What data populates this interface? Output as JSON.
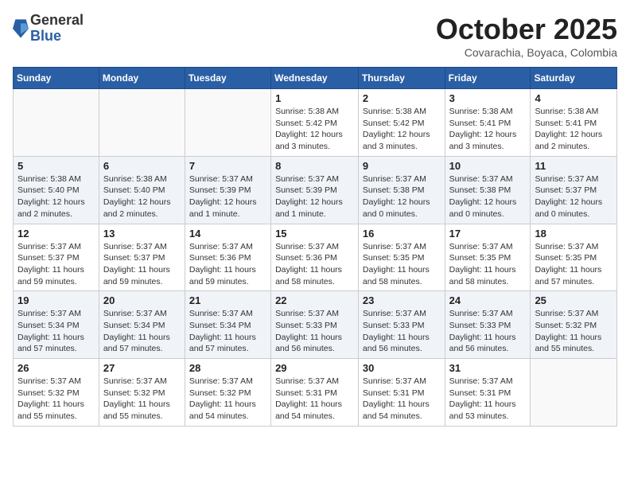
{
  "header": {
    "logo": {
      "general": "General",
      "blue": "Blue"
    },
    "title": "October 2025",
    "subtitle": "Covarachia, Boyaca, Colombia"
  },
  "weekdays": [
    "Sunday",
    "Monday",
    "Tuesday",
    "Wednesday",
    "Thursday",
    "Friday",
    "Saturday"
  ],
  "weeks": [
    [
      {
        "day": "",
        "info": ""
      },
      {
        "day": "",
        "info": ""
      },
      {
        "day": "",
        "info": ""
      },
      {
        "day": "1",
        "info": "Sunrise: 5:38 AM\nSunset: 5:42 PM\nDaylight: 12 hours\nand 3 minutes."
      },
      {
        "day": "2",
        "info": "Sunrise: 5:38 AM\nSunset: 5:42 PM\nDaylight: 12 hours\nand 3 minutes."
      },
      {
        "day": "3",
        "info": "Sunrise: 5:38 AM\nSunset: 5:41 PM\nDaylight: 12 hours\nand 3 minutes."
      },
      {
        "day": "4",
        "info": "Sunrise: 5:38 AM\nSunset: 5:41 PM\nDaylight: 12 hours\nand 2 minutes."
      }
    ],
    [
      {
        "day": "5",
        "info": "Sunrise: 5:38 AM\nSunset: 5:40 PM\nDaylight: 12 hours\nand 2 minutes."
      },
      {
        "day": "6",
        "info": "Sunrise: 5:38 AM\nSunset: 5:40 PM\nDaylight: 12 hours\nand 2 minutes."
      },
      {
        "day": "7",
        "info": "Sunrise: 5:37 AM\nSunset: 5:39 PM\nDaylight: 12 hours\nand 1 minute."
      },
      {
        "day": "8",
        "info": "Sunrise: 5:37 AM\nSunset: 5:39 PM\nDaylight: 12 hours\nand 1 minute."
      },
      {
        "day": "9",
        "info": "Sunrise: 5:37 AM\nSunset: 5:38 PM\nDaylight: 12 hours\nand 0 minutes."
      },
      {
        "day": "10",
        "info": "Sunrise: 5:37 AM\nSunset: 5:38 PM\nDaylight: 12 hours\nand 0 minutes."
      },
      {
        "day": "11",
        "info": "Sunrise: 5:37 AM\nSunset: 5:37 PM\nDaylight: 12 hours\nand 0 minutes."
      }
    ],
    [
      {
        "day": "12",
        "info": "Sunrise: 5:37 AM\nSunset: 5:37 PM\nDaylight: 11 hours\nand 59 minutes."
      },
      {
        "day": "13",
        "info": "Sunrise: 5:37 AM\nSunset: 5:37 PM\nDaylight: 11 hours\nand 59 minutes."
      },
      {
        "day": "14",
        "info": "Sunrise: 5:37 AM\nSunset: 5:36 PM\nDaylight: 11 hours\nand 59 minutes."
      },
      {
        "day": "15",
        "info": "Sunrise: 5:37 AM\nSunset: 5:36 PM\nDaylight: 11 hours\nand 58 minutes."
      },
      {
        "day": "16",
        "info": "Sunrise: 5:37 AM\nSunset: 5:35 PM\nDaylight: 11 hours\nand 58 minutes."
      },
      {
        "day": "17",
        "info": "Sunrise: 5:37 AM\nSunset: 5:35 PM\nDaylight: 11 hours\nand 58 minutes."
      },
      {
        "day": "18",
        "info": "Sunrise: 5:37 AM\nSunset: 5:35 PM\nDaylight: 11 hours\nand 57 minutes."
      }
    ],
    [
      {
        "day": "19",
        "info": "Sunrise: 5:37 AM\nSunset: 5:34 PM\nDaylight: 11 hours\nand 57 minutes."
      },
      {
        "day": "20",
        "info": "Sunrise: 5:37 AM\nSunset: 5:34 PM\nDaylight: 11 hours\nand 57 minutes."
      },
      {
        "day": "21",
        "info": "Sunrise: 5:37 AM\nSunset: 5:34 PM\nDaylight: 11 hours\nand 57 minutes."
      },
      {
        "day": "22",
        "info": "Sunrise: 5:37 AM\nSunset: 5:33 PM\nDaylight: 11 hours\nand 56 minutes."
      },
      {
        "day": "23",
        "info": "Sunrise: 5:37 AM\nSunset: 5:33 PM\nDaylight: 11 hours\nand 56 minutes."
      },
      {
        "day": "24",
        "info": "Sunrise: 5:37 AM\nSunset: 5:33 PM\nDaylight: 11 hours\nand 56 minutes."
      },
      {
        "day": "25",
        "info": "Sunrise: 5:37 AM\nSunset: 5:32 PM\nDaylight: 11 hours\nand 55 minutes."
      }
    ],
    [
      {
        "day": "26",
        "info": "Sunrise: 5:37 AM\nSunset: 5:32 PM\nDaylight: 11 hours\nand 55 minutes."
      },
      {
        "day": "27",
        "info": "Sunrise: 5:37 AM\nSunset: 5:32 PM\nDaylight: 11 hours\nand 55 minutes."
      },
      {
        "day": "28",
        "info": "Sunrise: 5:37 AM\nSunset: 5:32 PM\nDaylight: 11 hours\nand 54 minutes."
      },
      {
        "day": "29",
        "info": "Sunrise: 5:37 AM\nSunset: 5:31 PM\nDaylight: 11 hours\nand 54 minutes."
      },
      {
        "day": "30",
        "info": "Sunrise: 5:37 AM\nSunset: 5:31 PM\nDaylight: 11 hours\nand 54 minutes."
      },
      {
        "day": "31",
        "info": "Sunrise: 5:37 AM\nSunset: 5:31 PM\nDaylight: 11 hours\nand 53 minutes."
      },
      {
        "day": "",
        "info": ""
      }
    ]
  ]
}
